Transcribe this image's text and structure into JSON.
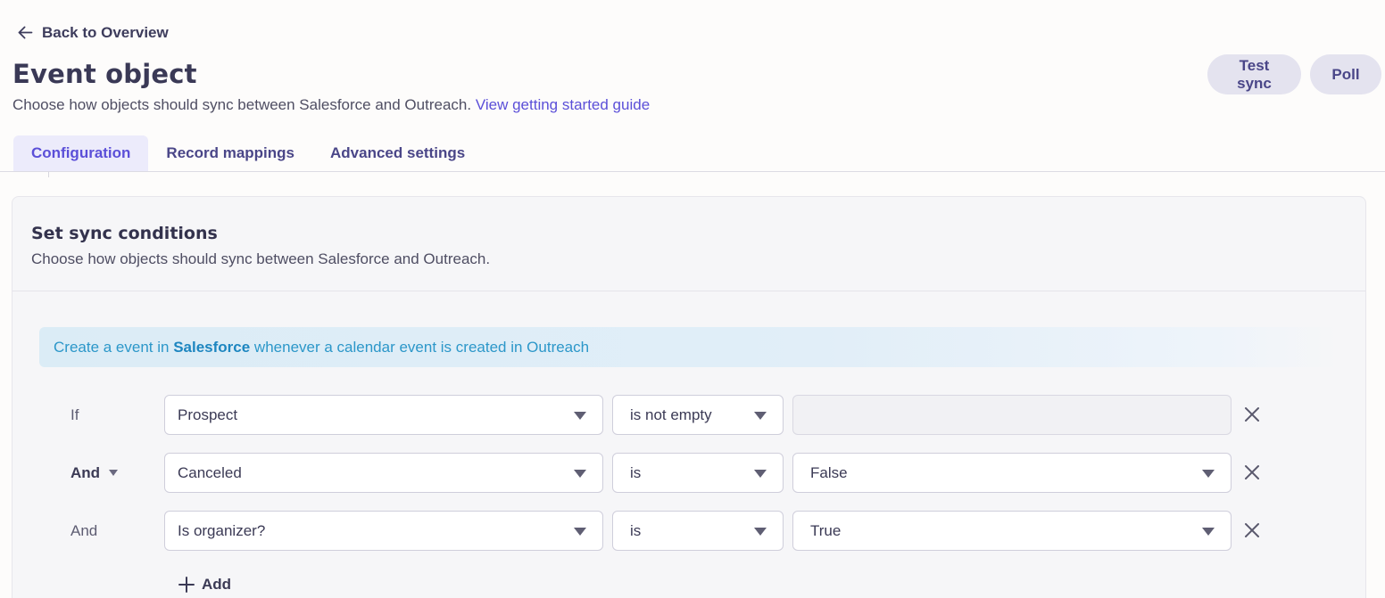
{
  "back_label": "Back to Overview",
  "title": "Event object",
  "subtitle": "Choose how objects should sync between Salesforce and Outreach.",
  "guide_link": "View getting started guide",
  "actions": {
    "test_sync": "Test sync",
    "poll": "Poll"
  },
  "tabs": [
    {
      "label": "Configuration",
      "active": true
    },
    {
      "label": "Record mappings",
      "active": false
    },
    {
      "label": "Advanced settings",
      "active": false
    }
  ],
  "card": {
    "title": "Set sync conditions",
    "description": "Choose how objects should sync between Salesforce and Outreach."
  },
  "banner": {
    "prefix": "Create a event in ",
    "target": "Salesforce",
    "suffix": " whenever a calendar event is created in Outreach"
  },
  "conditions": [
    {
      "label": "If",
      "field": "Prospect",
      "operator": "is not empty",
      "value": ""
    },
    {
      "label": "And",
      "field": "Canceled",
      "operator": "is",
      "value": "False"
    },
    {
      "label": "And",
      "field": "Is organizer?",
      "operator": "is",
      "value": "True"
    }
  ],
  "add_label": "Add",
  "colors": {
    "accent": "#5b4fd8",
    "banner_text": "#2c97c9",
    "pill_bg": "#e4e3ef"
  }
}
